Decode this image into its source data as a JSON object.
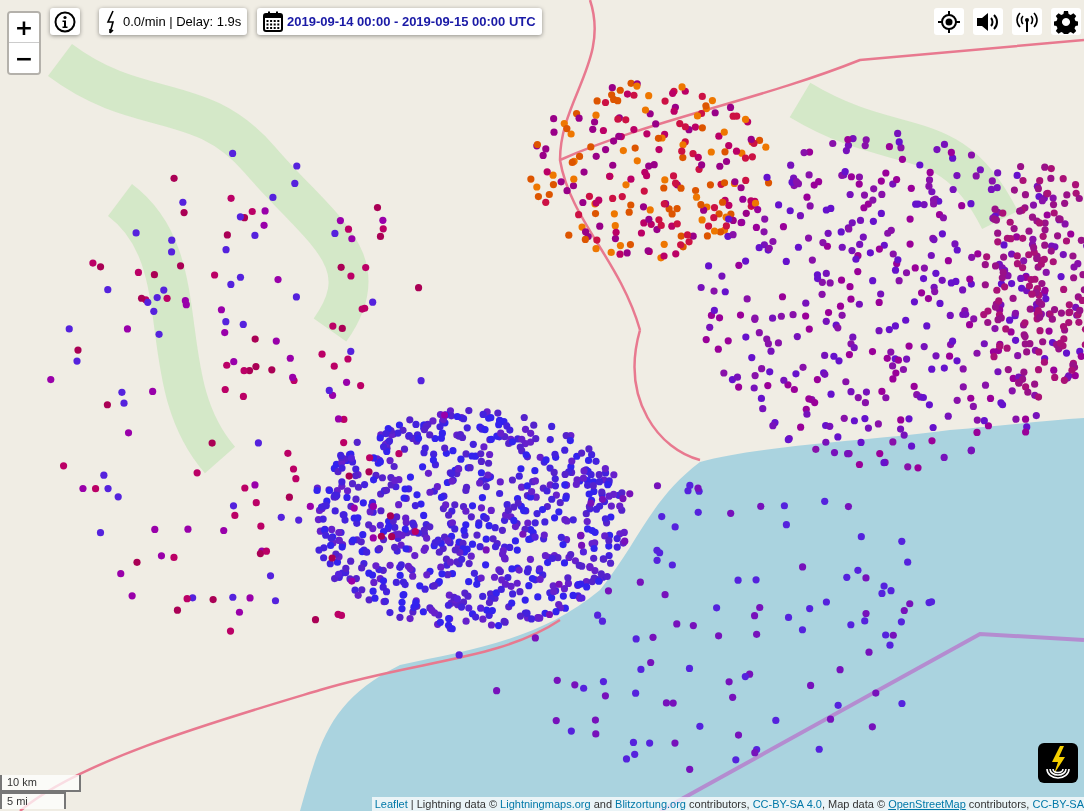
{
  "zoom_controls": [
    {
      "label": "+",
      "kind": "in"
    },
    {
      "label": "−",
      "kind": "out"
    }
  ],
  "rate_panel": {
    "text": "0.0/min | Delay: 1.9s"
  },
  "time_range": {
    "text": "2019-09-14 00:00 - 2019-09-15 00:00 UTC"
  },
  "scale": {
    "metric": "10 km",
    "imperial": "5 mi"
  },
  "attribution": [
    {
      "kind": "link",
      "text": "Leaflet"
    },
    {
      "kind": "text",
      "text": " | Lightning data © "
    },
    {
      "kind": "link",
      "text": "Lightningmaps.org"
    },
    {
      "kind": "text",
      "text": " and "
    },
    {
      "kind": "link",
      "text": "Blitzortung.org"
    },
    {
      "kind": "text",
      "text": " contributors, "
    },
    {
      "kind": "link",
      "text": "CC-BY-SA 4.0"
    },
    {
      "kind": "text",
      "text": ", Map data © "
    },
    {
      "kind": "underlined-link",
      "text": "OpenStreetMap"
    },
    {
      "kind": "text",
      "text": " contributors, "
    },
    {
      "kind": "link",
      "text": "CC-BY-SA"
    }
  ]
}
